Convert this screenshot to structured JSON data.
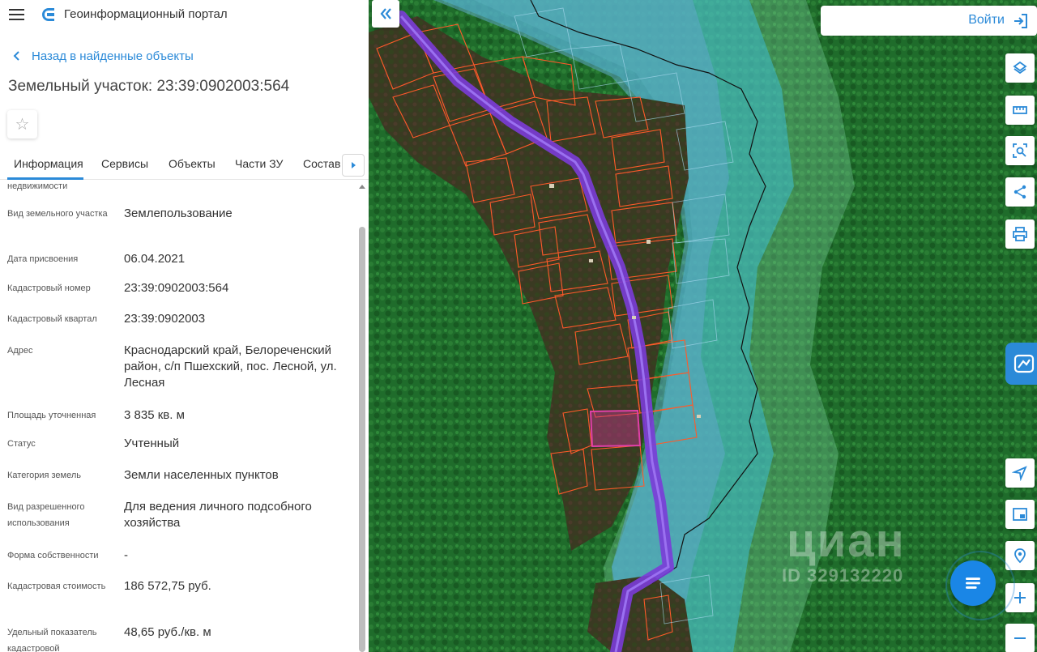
{
  "header": {
    "app_title": "Геоинформационный портал"
  },
  "navigation": {
    "back_label": "Назад в найденные объекты"
  },
  "page": {
    "title": "Земельный участок: 23:39:0902003:564"
  },
  "tabs": [
    {
      "label": "Информация",
      "active": true
    },
    {
      "label": "Сервисы"
    },
    {
      "label": "Объекты"
    },
    {
      "label": "Части ЗУ"
    },
    {
      "label": "Состав"
    }
  ],
  "info": {
    "top_partial_label": "недвижимости",
    "fields": [
      {
        "label": "Вид земельного участка",
        "value": "Землепользование"
      },
      {
        "label": "Дата присвоения",
        "value": "06.04.2021"
      },
      {
        "label": "Кадастровый номер",
        "value": "23:39:0902003:564"
      },
      {
        "label": "Кадастровый квартал",
        "value": "23:39:0902003"
      },
      {
        "label": "Адрес",
        "value": "Краснодарский край, Белореченский район, с/п Пшехский, пос. Лесной, ул. Лесная"
      },
      {
        "label": "Площадь уточненная",
        "value": "3 835 кв. м"
      },
      {
        "label": "Статус",
        "value": "Учтенный"
      },
      {
        "label": "Категория земель",
        "value": "Земли населенных пунктов"
      },
      {
        "label": "Вид разрешенного использования",
        "value": "Для ведения личного подсобного хозяйства"
      },
      {
        "label": "Форма собственности",
        "value": "-"
      },
      {
        "label": "Кадастровая стоимость",
        "value": "186 572,75 руб."
      },
      {
        "label": "Удельный показатель кадастровой",
        "value": "48,65 руб./кв. м"
      }
    ]
  },
  "map": {
    "login_label": "Войти",
    "collapse_icon": "double-chevron-left-icon",
    "tools": [
      "layers-icon",
      "ruler-icon",
      "area-search-icon",
      "share-icon",
      "print-icon"
    ],
    "bottom_tools": [
      "navigate-arrow-icon",
      "minimap-icon",
      "locate-icon",
      "zoom-in-icon",
      "zoom-out-icon"
    ],
    "watermark_name": "циан",
    "watermark_id": "ID 329132220"
  },
  "colors": {
    "accent": "#2b8ad8",
    "parcel_outline": "#ff5a2a",
    "selected_parcel": "#d03a9a",
    "road": "#7b3cd8",
    "buffer_zone": "#48c0d8"
  }
}
